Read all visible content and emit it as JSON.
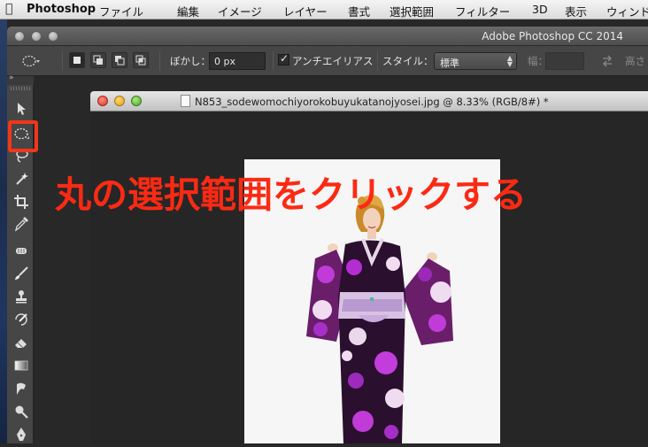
{
  "menubar": {
    "app_name": "Photoshop",
    "items": [
      "ファイル",
      "編集",
      "イメージ",
      "レイヤー",
      "書式",
      "選択範囲",
      "フィルター",
      "3D",
      "表示",
      "ウィンドウ"
    ]
  },
  "app_window": {
    "title": "Adobe Photoshop CC 2014"
  },
  "options_bar": {
    "feather_label": "ぼかし：",
    "feather_value": "0 px",
    "antialias_label": "アンチエイリアス",
    "antialias_checked": true,
    "style_label": "スタイル：",
    "style_value": "標準",
    "width_label": "幅：",
    "height_label": "高さ"
  },
  "document": {
    "title": "N853_sodewomochiyorokobuyukatanojyosei.jpg @ 8.33% (RGB/8#) *"
  },
  "annotation": {
    "text": "丸の選択範囲をクリックする",
    "color": "#ff2a14"
  },
  "tools": [
    {
      "name": "move-tool-icon"
    },
    {
      "name": "elliptical-marquee-tool-icon",
      "selected": true
    },
    {
      "name": "lasso-tool-icon"
    },
    {
      "name": "magic-wand-tool-icon"
    },
    {
      "name": "crop-tool-icon"
    },
    {
      "name": "eyedropper-tool-icon"
    },
    {
      "name": "spot-healing-tool-icon"
    },
    {
      "name": "brush-tool-icon"
    },
    {
      "name": "clone-stamp-tool-icon"
    },
    {
      "name": "history-brush-tool-icon"
    },
    {
      "name": "eraser-tool-icon"
    },
    {
      "name": "gradient-tool-icon"
    },
    {
      "name": "smudge-tool-icon"
    },
    {
      "name": "dodge-tool-icon"
    },
    {
      "name": "pen-tool-icon"
    }
  ]
}
